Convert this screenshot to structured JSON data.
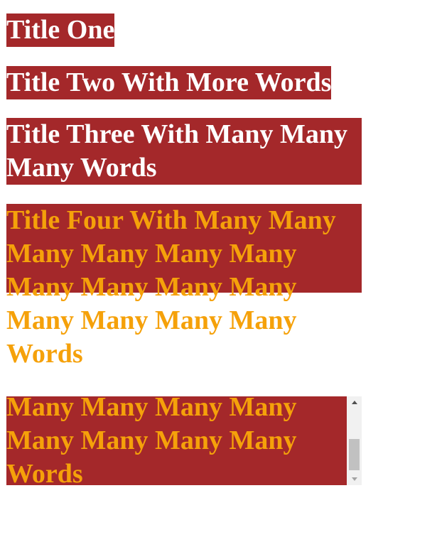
{
  "titles": [
    {
      "text": "Title One"
    },
    {
      "text": "Title Two With More Words"
    },
    {
      "text": "Title Three With Many Many Many Words"
    },
    {
      "text": "Title Four With Many Many Many Many Many Many Many Many Many Many Many Many Many Many Words"
    },
    {
      "text": "Title Five With Many Many Many Many Many Many Many Many Many Many Many Many Many Many Words"
    }
  ],
  "colors": {
    "box_background": "#a4282a",
    "white_text": "#ffffff",
    "orange_text": "#f5a10a"
  },
  "scroll": {
    "thumb_position": 0.75
  }
}
